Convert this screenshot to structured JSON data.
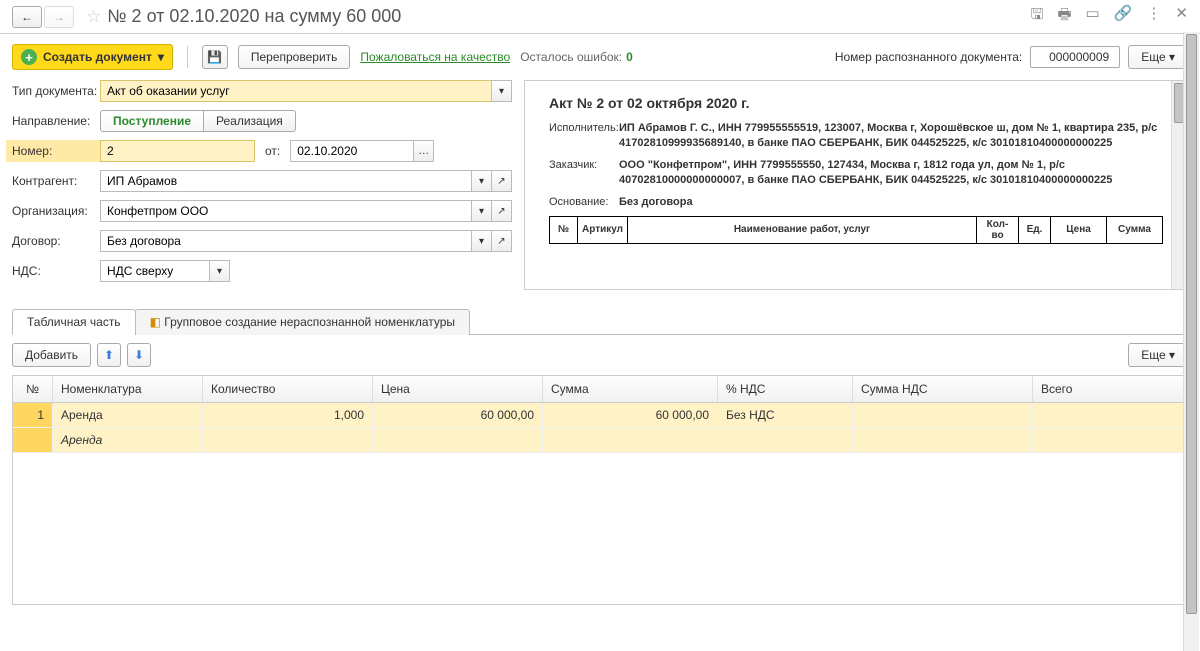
{
  "header": {
    "title": "№ 2 от 02.10.2020 на сумму 60 000"
  },
  "toolbar": {
    "create_doc": "Создать документ",
    "recheck": "Перепроверить",
    "complain": "Пожаловаться на качество",
    "errors_left": "Осталось ошибок:",
    "errors_count": "0",
    "doc_num_label": "Номер распознанного документа:",
    "doc_num": "000000009",
    "more": "Еще"
  },
  "form": {
    "doctype_label": "Тип документа:",
    "doctype": "Акт об оказании услуг",
    "direction_label": "Направление:",
    "dir_in": "Поступление",
    "dir_out": "Реализация",
    "number_label": "Номер:",
    "number": "2",
    "ot_label": "от:",
    "date": "02.10.2020",
    "counterparty_label": "Контрагент:",
    "counterparty": "ИП Абрамов",
    "org_label": "Организация:",
    "org": "Конфетпром ООО",
    "contract_label": "Договор:",
    "contract": "Без договора",
    "vat_label": "НДС:",
    "vat": "НДС сверху"
  },
  "preview": {
    "title": "Акт № 2 от 02 октября 2020 г.",
    "executor_label": "Исполнитель:",
    "executor": "ИП Абрамов Г. С., ИНН 779955555519, 123007, Москва г, Хорошёвское ш, дом № 1, квартира 235, р/с 41702810999935689140, в банке ПАО СБЕРБАНК, БИК 044525225, к/с 30101810400000000225",
    "customer_label": "Заказчик:",
    "customer": "ООО \"Конфетпром\", ИНН 7799555550, 127434, Москва г, 1812 года ул, дом № 1, р/с 40702810000000000007, в банке ПАО СБЕРБАНК, БИК 044525225, к/с 30101810400000000225",
    "basis_label": "Основание:",
    "basis": "Без договора",
    "th_no": "№",
    "th_art": "Артикул",
    "th_name": "Наименование работ, услуг",
    "th_qty": "Кол-во",
    "th_unit": "Ед.",
    "th_price": "Цена",
    "th_sum": "Сумма"
  },
  "tabs": {
    "tab1": "Табличная часть",
    "tab2": "Групповое создание нераспознанной номенклатуры",
    "add": "Добавить",
    "more": "Еще"
  },
  "tableHeaders": {
    "no": "№",
    "nom": "Номенклатура",
    "qty": "Количество",
    "price": "Цена",
    "sum": "Сумма",
    "vat": "% НДС",
    "vatsum": "Сумма НДС",
    "total": "Всего"
  },
  "rows": [
    {
      "no": "1",
      "nom": "Аренда",
      "qty": "1,000",
      "price": "60 000,00",
      "sum": "60 000,00",
      "vat": "Без НДС",
      "vatsum": "",
      "total": "",
      "nom2": "Аренда"
    }
  ]
}
